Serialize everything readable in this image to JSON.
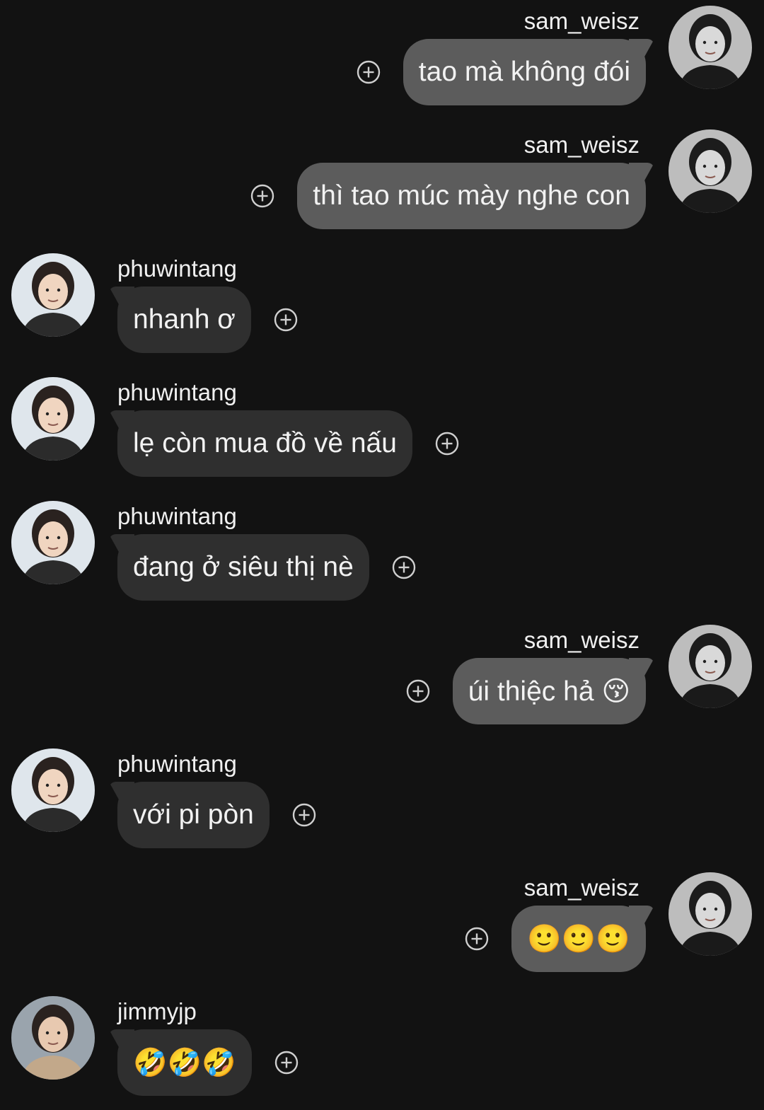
{
  "users": {
    "sam": {
      "name": "sam_weisz",
      "avatar_icon": "user-avatar-icon"
    },
    "phuw": {
      "name": "phuwintang",
      "avatar_icon": "user-avatar-icon"
    },
    "jimmy": {
      "name": "jimmyjp",
      "avatar_icon": "user-avatar-icon"
    }
  },
  "messages": [
    {
      "side": "right",
      "user": "sam",
      "username": "sam_weisz",
      "text": "tao mà không đói"
    },
    {
      "side": "right",
      "user": "sam",
      "username": "sam_weisz",
      "text": "thì tao múc mày nghe con"
    },
    {
      "side": "left",
      "user": "phuw",
      "username": "phuwintang",
      "text": "nhanh ơ"
    },
    {
      "side": "left",
      "user": "phuw",
      "username": "phuwintang",
      "text": "lẹ còn mua đồ về nấu"
    },
    {
      "side": "left",
      "user": "phuw",
      "username": "phuwintang",
      "text": "đang ở siêu thị nè"
    },
    {
      "side": "right",
      "user": "sam",
      "username": "sam_weisz",
      "text": "úi thiệc hả 😚"
    },
    {
      "side": "left",
      "user": "phuw",
      "username": "phuwintang",
      "text": "với pi pòn"
    },
    {
      "side": "right",
      "user": "sam",
      "username": "sam_weisz",
      "text": "🙂🙂🙂"
    },
    {
      "side": "left",
      "user": "jimmy",
      "username": "jimmyjp",
      "text": "🤣🤣🤣"
    }
  ],
  "react_button_icon": "add-reaction-icon",
  "colors": {
    "background": "#121212",
    "incoming_bubble": "#2f2f2f",
    "outgoing_bubble": "#5c5c5c",
    "text": "#f2f2f2",
    "icon": "#cfcfcf"
  }
}
